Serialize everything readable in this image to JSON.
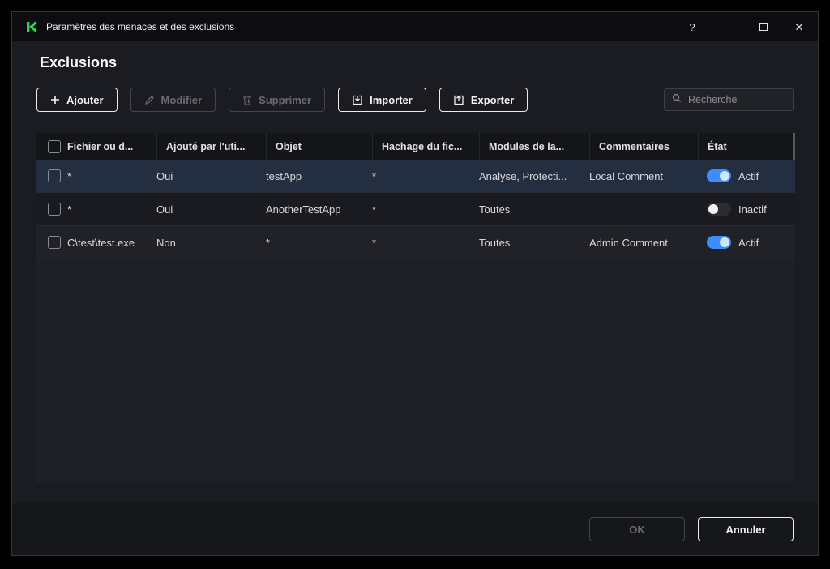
{
  "window": {
    "title": "Paramètres des menaces et des exclusions",
    "controls": {
      "help": "?",
      "minimize": "–",
      "close": "✕"
    }
  },
  "page": {
    "title": "Exclusions"
  },
  "toolbar": {
    "add": "Ajouter",
    "edit": "Modifier",
    "delete": "Supprimer",
    "import": "Importer",
    "export": "Exporter",
    "search_placeholder": "Recherche"
  },
  "table": {
    "columns": [
      "Fichier ou d...",
      "Ajouté par l'uti...",
      "Objet",
      "Hachage du fic...",
      "Modules de la...",
      "Commentaires",
      "État"
    ],
    "rows": [
      {
        "file": "*",
        "added_by_user": "Oui",
        "object": "testApp",
        "hash": "*",
        "modules": "Analyse, Protecti...",
        "comment": "Local Comment",
        "state": "Actif",
        "enabled": true,
        "selected": true
      },
      {
        "file": "*",
        "added_by_user": "Oui",
        "object": "AnotherTestApp",
        "hash": "*",
        "modules": "Toutes",
        "comment": "",
        "state": "Inactif",
        "enabled": false,
        "selected": false
      },
      {
        "file": "C\\test\\test.exe",
        "added_by_user": "Non",
        "object": "*",
        "hash": "*",
        "modules": "Toutes",
        "comment": "Admin Comment",
        "state": "Actif",
        "enabled": true,
        "selected": false
      }
    ]
  },
  "footer": {
    "ok": "OK",
    "cancel": "Annuler"
  },
  "colors": {
    "accent_green": "#2fd153",
    "toggle_on": "#3f8cff"
  }
}
